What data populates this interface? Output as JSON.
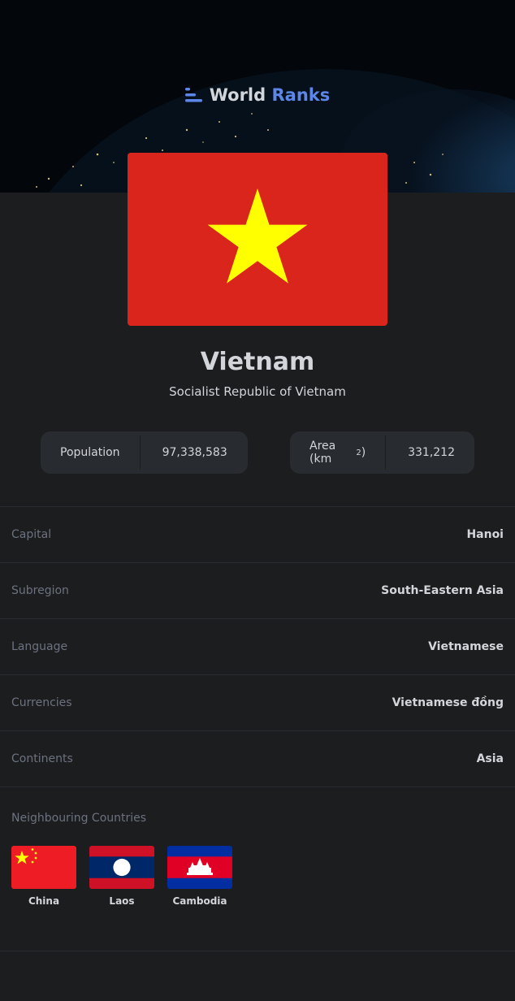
{
  "brand": {
    "word1": "World",
    "word2": "Ranks"
  },
  "country": {
    "name": "Vietnam",
    "official_name": "Socialist Republic of Vietnam"
  },
  "stats": {
    "population_label": "Population",
    "population_value": "97,338,583",
    "area_label": "Area (km",
    "area_sup": "2",
    "area_close": ")",
    "area_value": "331,212"
  },
  "details": [
    {
      "label": "Capital",
      "value": "Hanoi"
    },
    {
      "label": "Subregion",
      "value": "South-Eastern Asia"
    },
    {
      "label": "Language",
      "value": "Vietnamese"
    },
    {
      "label": "Currencies",
      "value": "Vietnamese đồng"
    },
    {
      "label": "Continents",
      "value": "Asia"
    }
  ],
  "neighbours": {
    "title": "Neighbouring Countries",
    "items": [
      {
        "name": "China"
      },
      {
        "name": "Laos"
      },
      {
        "name": "Cambodia"
      }
    ]
  },
  "colors": {
    "background": "#1b1d1f",
    "card": "#282b30",
    "accent": "#5c86e8",
    "text": "#d2d5da",
    "muted": "#6c727f"
  }
}
